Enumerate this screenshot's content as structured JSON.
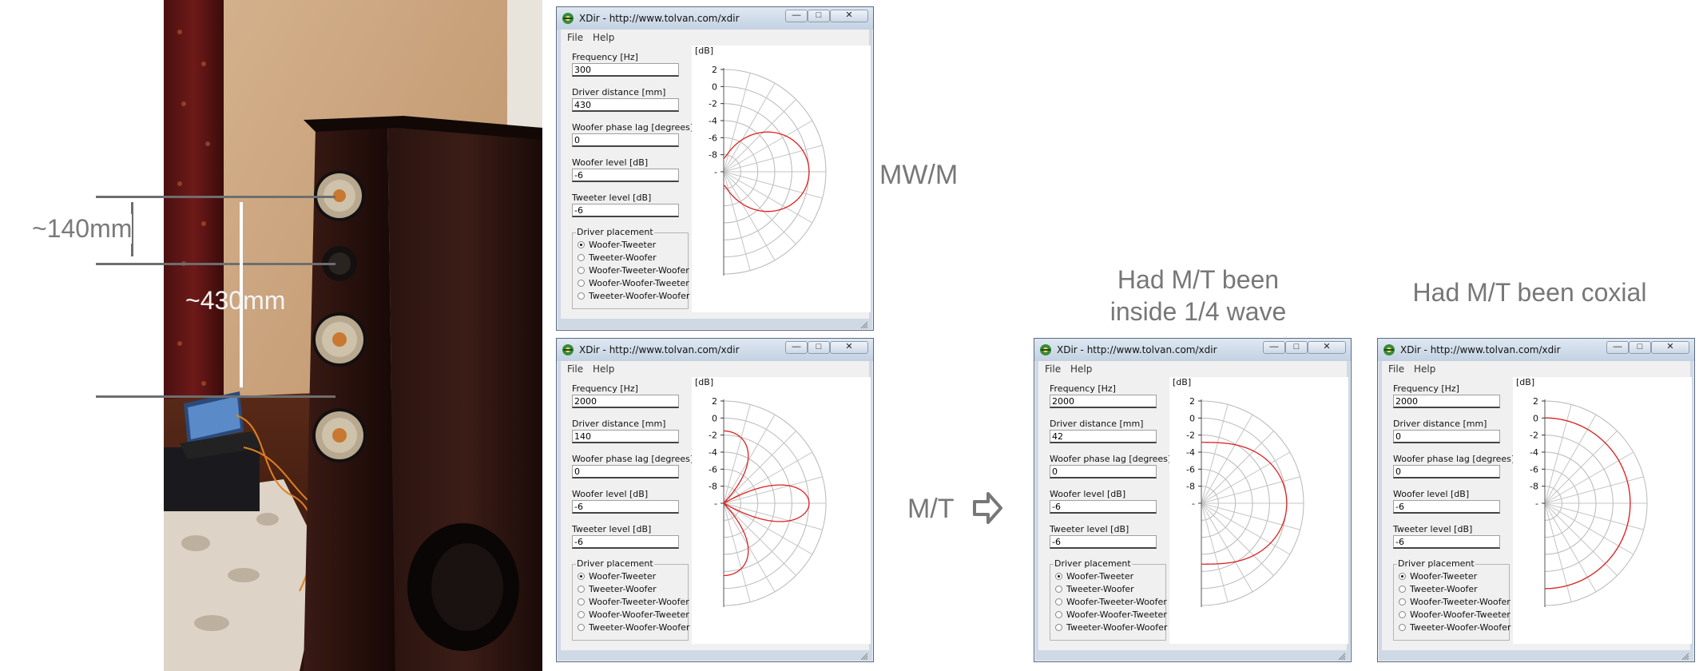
{
  "app_title": "XDir - http://www.tolvan.com/xdir",
  "menu": [
    "File",
    "Help"
  ],
  "field_labels": {
    "frequency": "Frequency [Hz]",
    "distance": "Driver distance [mm]",
    "phase": "Woofer phase lag [degrees]",
    "woofer_level": "Woofer level [dB]",
    "tweeter_level": "Tweeter level [dB]"
  },
  "placement_group_label": "Driver placement",
  "placement_options": [
    "Woofer-Tweeter",
    "Tweeter-Woofer",
    "Woofer-Tweeter-Woofer",
    "Woofer-Woofer-Tweeter",
    "Tweeter-Woofer-Woofer"
  ],
  "db_unit": "[dB]",
  "db_ticks": [
    "2",
    "0",
    "-2",
    "-4",
    "-6",
    "-8",
    "-"
  ],
  "plot_color": "#e02020",
  "annotations": {
    "d140": "~140mm",
    "d430": "~430mm",
    "mwm": "MW/M",
    "mt": "M/T",
    "heading_quarter_line1": "Had M/T been",
    "heading_quarter_line2": "inside 1/4 wave",
    "heading_coaxial": "Had M/T been coxial"
  },
  "windows": [
    {
      "id": "w1",
      "frequency": "300",
      "distance": "430",
      "phase": "0",
      "woofer_level": "-6",
      "tweeter_level": "-6",
      "selected_placement": "Woofer-Tweeter"
    },
    {
      "id": "w2",
      "frequency": "2000",
      "distance": "140",
      "phase": "0",
      "woofer_level": "-6",
      "tweeter_level": "-6",
      "selected_placement": "Woofer-Tweeter"
    },
    {
      "id": "w3",
      "frequency": "2000",
      "distance": "42",
      "phase": "0",
      "woofer_level": "-6",
      "tweeter_level": "-6",
      "selected_placement": "Woofer-Tweeter"
    },
    {
      "id": "w4",
      "frequency": "2000",
      "distance": "0",
      "phase": "0",
      "woofer_level": "-6",
      "tweeter_level": "-6",
      "selected_placement": "Woofer-Tweeter"
    }
  ]
}
